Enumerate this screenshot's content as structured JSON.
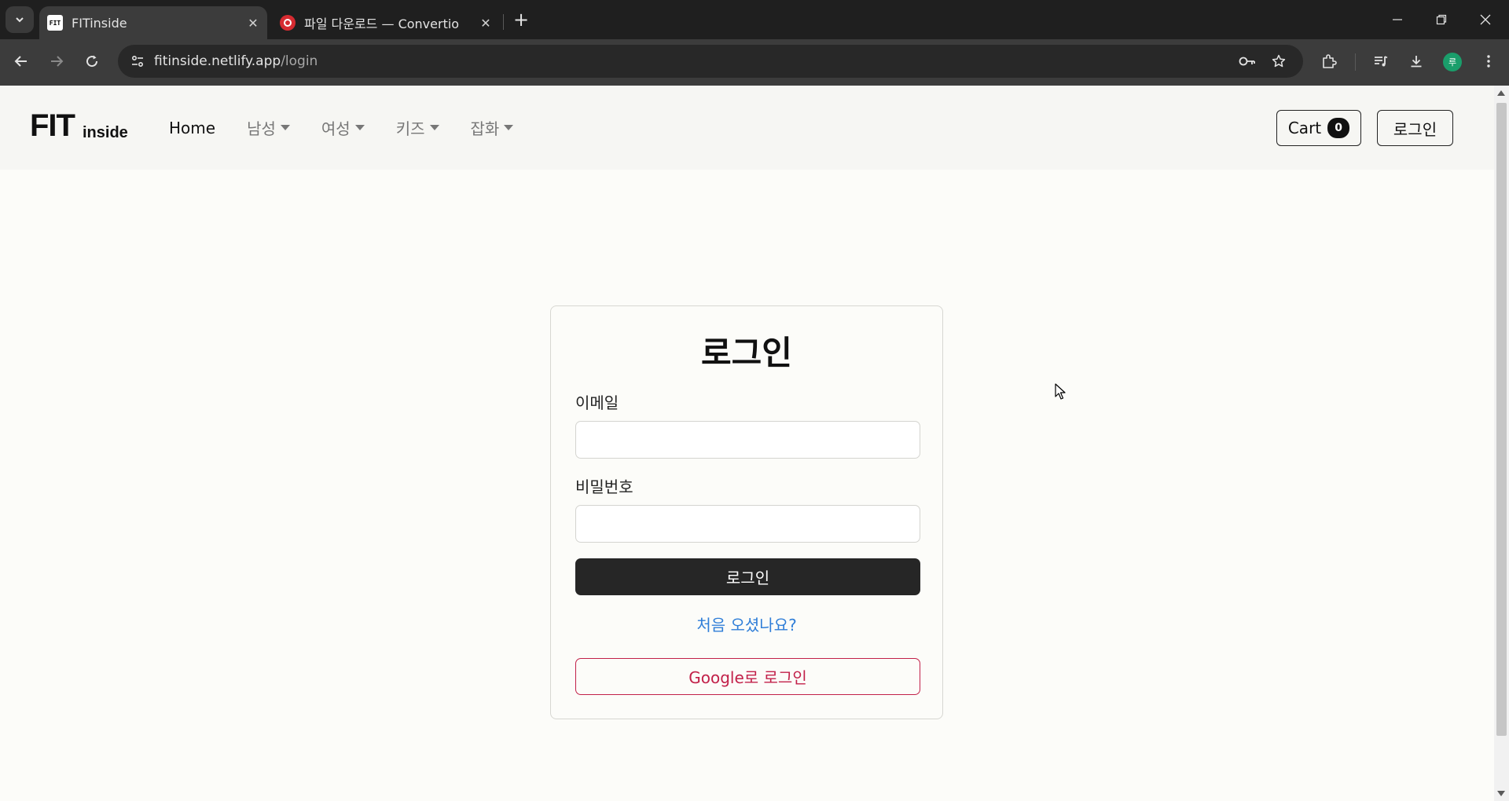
{
  "browser": {
    "tabs": [
      {
        "title": "FITinside",
        "favicon_text": "FIT",
        "active": true
      },
      {
        "title": "파일 다운로드 — Convertio",
        "active": false
      }
    ],
    "url_host": "fitinside.netlify.app",
    "url_path": "/login",
    "profile_initial": "루"
  },
  "site": {
    "logo_main": "FIT",
    "logo_sub": "inside",
    "nav": [
      {
        "label": "Home",
        "dropdown": false
      },
      {
        "label": "남성",
        "dropdown": true
      },
      {
        "label": "여성",
        "dropdown": true
      },
      {
        "label": "키즈",
        "dropdown": true
      },
      {
        "label": "잡화",
        "dropdown": true
      }
    ],
    "cart_label": "Cart",
    "cart_count": "0",
    "login_button": "로그인"
  },
  "login_form": {
    "title": "로그인",
    "email_label": "이메일",
    "email_value": "",
    "password_label": "비밀번호",
    "password_value": "",
    "submit_label": "로그인",
    "signup_link": "처음 오셨나요?",
    "google_label": "Google로 로그인"
  },
  "colors": {
    "submit_bg": "#262626",
    "link": "#2f7ed8",
    "google_accent": "#c22049",
    "page_bg": "#fcfcf9"
  }
}
